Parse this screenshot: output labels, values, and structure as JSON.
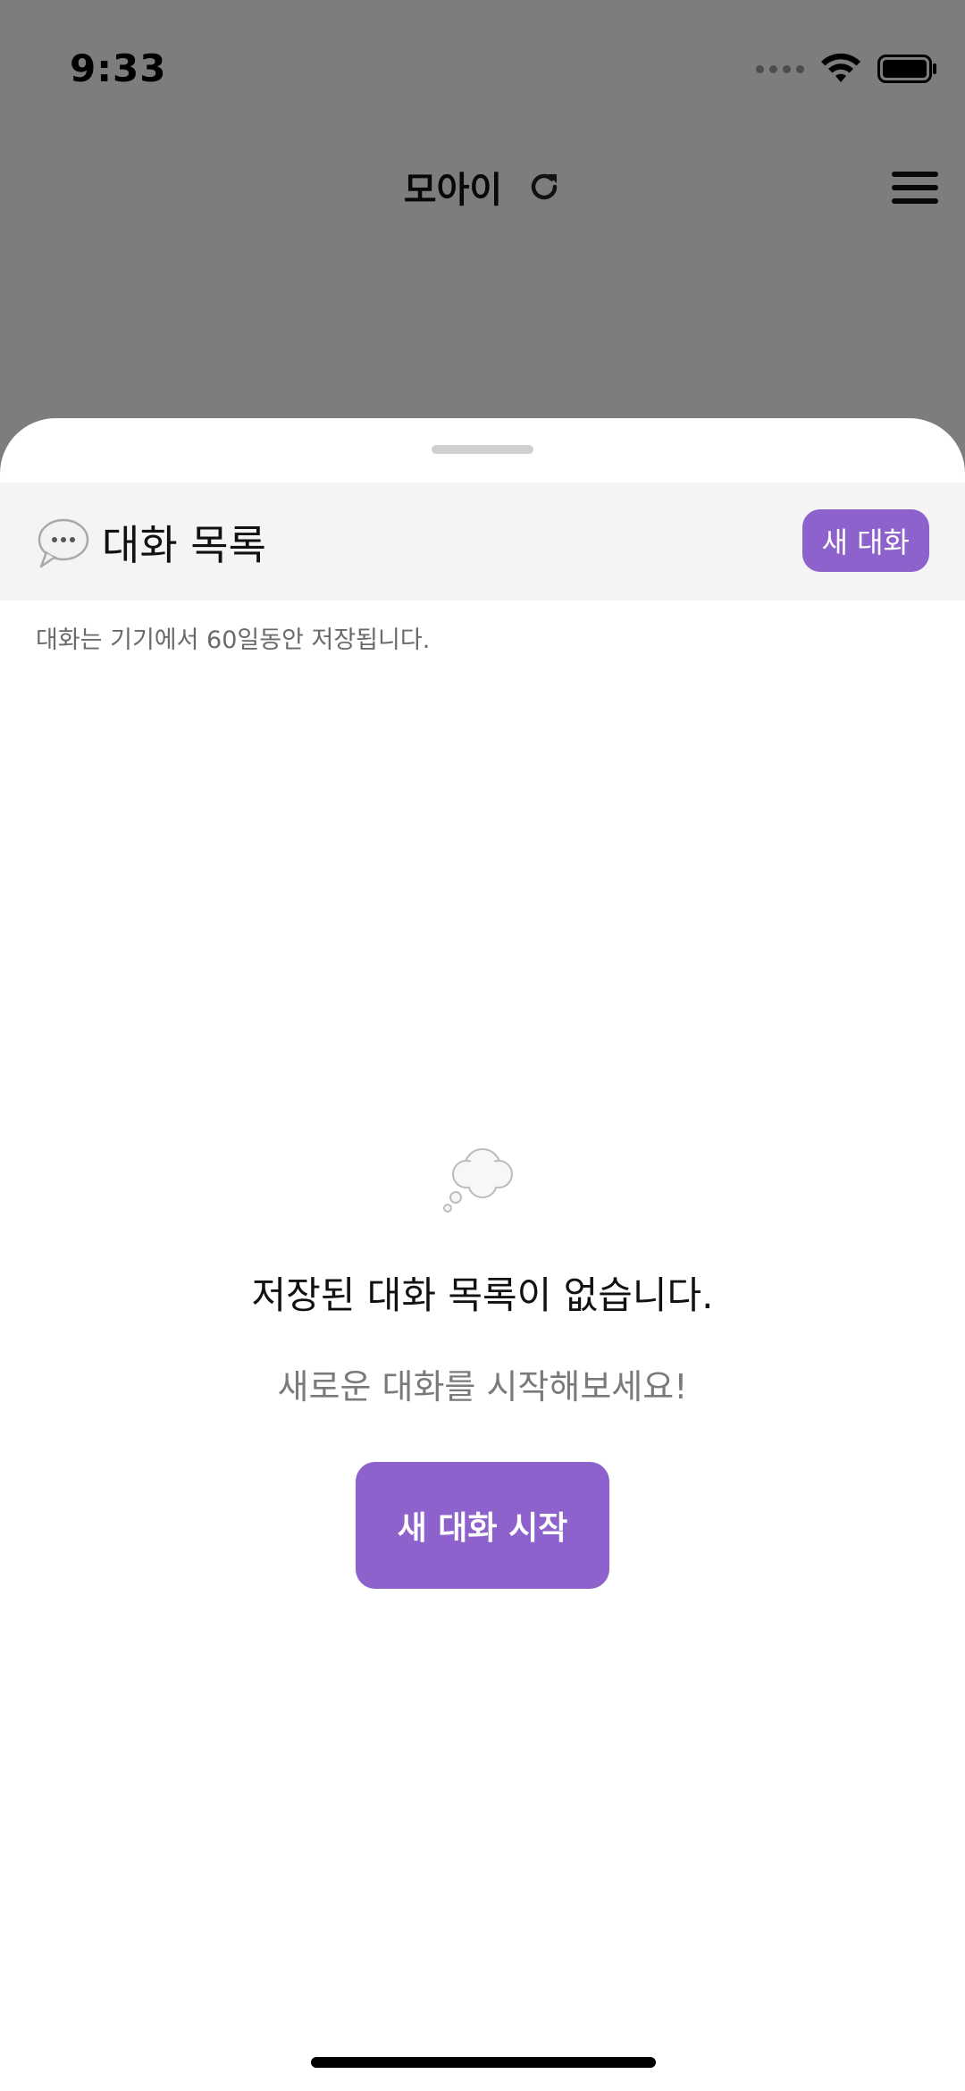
{
  "status_bar": {
    "time": "9:33"
  },
  "app_header": {
    "title": "모아이"
  },
  "sheet": {
    "title": "대화 목록",
    "new_chat_label": "새 대화",
    "retention_note": "대화는 기기에서 60일동안 저장됩니다."
  },
  "empty_state": {
    "title": "저장된 대화 목록이 없습니다.",
    "subtitle": "새로운 대화를 시작해보세요!",
    "start_label": "새 대화 시작"
  },
  "icons": {
    "refresh": "refresh-icon",
    "menu": "hamburger-menu-icon",
    "speech_bubble": "speech-bubble-icon",
    "thought_bubble": "thought-bubble-icon",
    "wifi": "wifi-icon",
    "battery": "battery-icon"
  },
  "colors": {
    "accent": "#8d62cc",
    "dim_overlay": "rgba(0,0,0,0.5)",
    "sheet_header_bg": "#f4f4f4"
  }
}
